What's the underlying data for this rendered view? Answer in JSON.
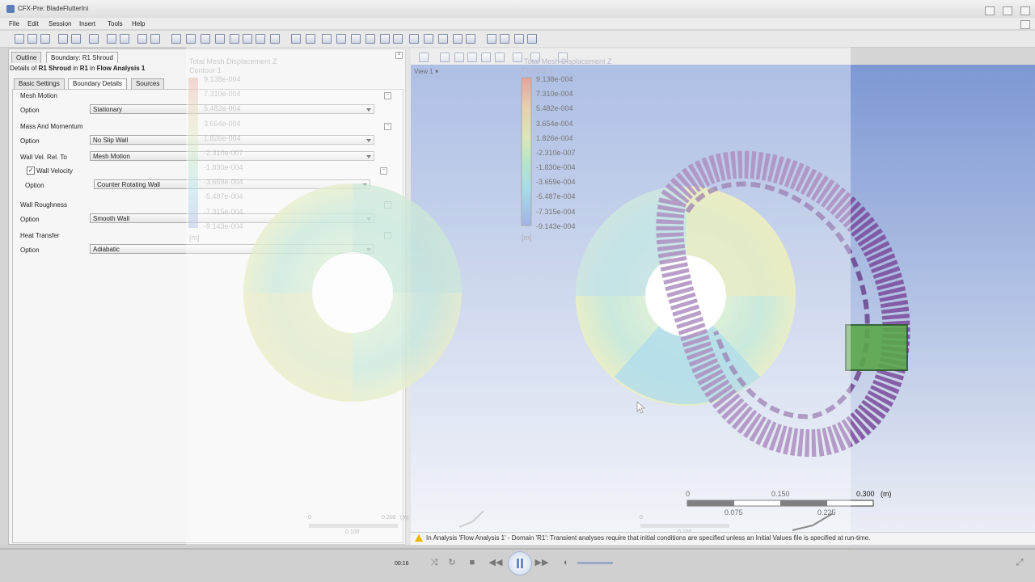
{
  "window": {
    "title": "CFX-Pre: BladeFlutterIni"
  },
  "menu": [
    "File",
    "Edit",
    "Session",
    "Insert",
    "Tools",
    "Help"
  ],
  "tabs": {
    "outline": "Outline",
    "boundary": "Boundary: R1 Shroud"
  },
  "details": {
    "prefix": "Details of ",
    "name": "R1 Shroud",
    "mid": " in ",
    "domain": "R1",
    "in_word": " in ",
    "analysis": "Flow Analysis 1"
  },
  "subtabs": {
    "basic": "Basic Settings",
    "boundary": "Boundary Details",
    "sources": "Sources"
  },
  "form": {
    "mesh_motion": {
      "title": "Mesh Motion",
      "option_label": "Option",
      "option_value": "Stationary"
    },
    "mass_momentum": {
      "title": "Mass And Momentum",
      "option_label": "Option",
      "option_value": "No Slip Wall",
      "wall_vel_label": "Wall Vel. Rel. To",
      "wall_vel_value": "Mesh Motion",
      "wall_velocity_label": "Wall Velocity",
      "wall_velocity_checked": true,
      "wv_option_label": "Option",
      "wv_option_value": "Counter Rotating Wall"
    },
    "wall_roughness": {
      "title": "Wall Roughness",
      "option_label": "Option",
      "option_value": "Smooth Wall"
    },
    "heat_transfer": {
      "title": "Heat Transfer",
      "option_label": "Option",
      "option_value": "Adiabatic"
    }
  },
  "viewport": {
    "view_label": "View 1",
    "legend_title": "Total Mesh Displacement Z",
    "legend_subtitle": "Contour 1",
    "legend_values": [
      "9.138e-004",
      "7.310e-004",
      "5.482e-004",
      "3.654e-004",
      "1.826e-004",
      "-2.310e-007",
      "-1.830e-004",
      "-3.659e-004",
      "-5.487e-004",
      "-7.315e-004",
      "-9.143e-004"
    ],
    "legend_unit": "[m]",
    "scale": {
      "top": [
        "0",
        "0.150",
        "0.300",
        "(m)"
      ],
      "bottom": [
        "0.075",
        "0.225"
      ]
    },
    "ghost_scale": {
      "top": [
        "0",
        "0.200",
        "(m)"
      ],
      "bottom": [
        "0.100"
      ]
    }
  },
  "status": {
    "message": "In Analysis 'Flow Analysis 1' - Domain 'R1': Transient analyses require that initial conditions are specified unless an Initial Values file is specified at run-time."
  },
  "player": {
    "time": "00:16"
  }
}
